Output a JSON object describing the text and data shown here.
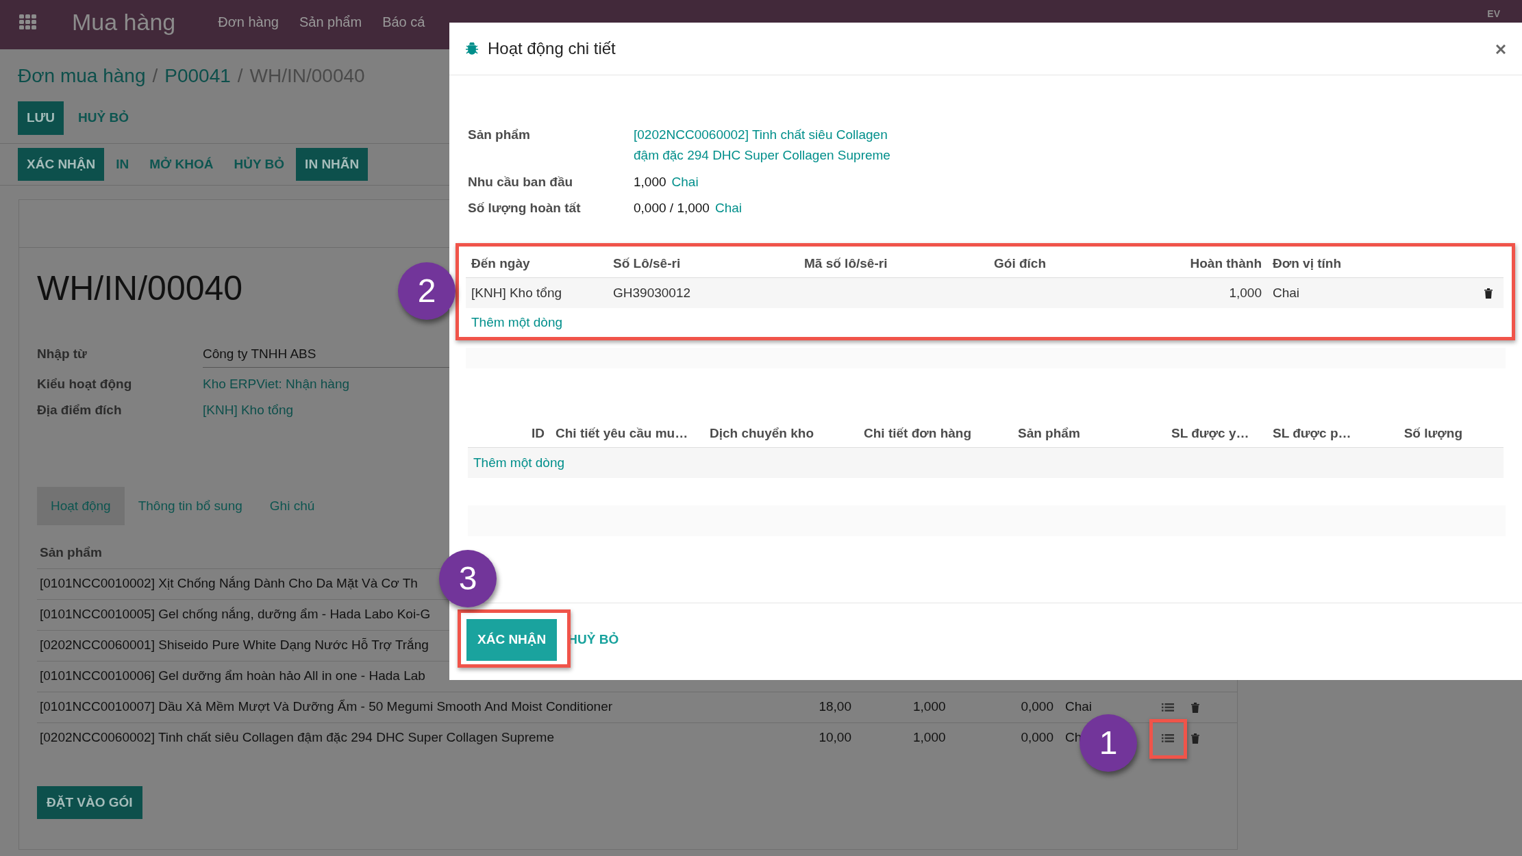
{
  "navbar": {
    "app": "Mua hàng",
    "menu": [
      "Đơn hàng",
      "Sản phẩm",
      "Báo cá"
    ],
    "user": "EV"
  },
  "breadcrumb": {
    "separator": "/",
    "items": [
      {
        "label": "Đơn mua hàng",
        "link": true
      },
      {
        "label": "P00041",
        "link": true
      },
      {
        "label": "WH/IN/00040",
        "link": false
      }
    ]
  },
  "edit_buttons": [
    {
      "label": "LƯU",
      "primary": true
    },
    {
      "label": "HUỶ BỎ",
      "primary": false
    }
  ],
  "status_buttons": [
    {
      "label": "XÁC NHẬN",
      "primary": true
    },
    {
      "label": "IN",
      "primary": false
    },
    {
      "label": "MỞ KHOÁ",
      "primary": false
    },
    {
      "label": "HỦY BỎ",
      "primary": false
    },
    {
      "label": "IN NHÃN",
      "primary": true
    }
  ],
  "record": {
    "title": "WH/IN/00040",
    "fields": [
      {
        "label": "Nhập từ",
        "value": "Công ty TNHH ABS",
        "kind": "input"
      },
      {
        "label": "Kiểu hoạt động",
        "value": "Kho ERPViet: Nhận hàng",
        "kind": "link"
      },
      {
        "label": "Địa điểm đích",
        "value": "[KNH] Kho tổng",
        "kind": "link"
      }
    ]
  },
  "tabs": [
    {
      "label": "Hoạt động",
      "selected": true
    },
    {
      "label": "Thông tin bổ sung",
      "selected": false
    },
    {
      "label": "Ghi chú",
      "selected": false
    }
  ],
  "operations": {
    "heading": "Sản phẩm",
    "rows": [
      {
        "product": "[0101NCC0010002] Xịt Chống Nắng Dành Cho Da Mặt Và Cơ Th"
      },
      {
        "product": "[0101NCC0010005] Gel chống nắng, dưỡng ẩm - Hada Labo Koi-G"
      },
      {
        "product": "[0202NCC0060001] Shiseido Pure White Dạng Nước Hỗ Trợ Trắng"
      },
      {
        "product": "[0101NCC0010006] Gel dưỡng ẩm hoàn hảo All in one - Hada Lab"
      },
      {
        "product": "[0101NCC0010007] Dầu Xả Mềm Mượt Và Dưỡng Ẩm - 50 Megumi Smooth And Moist Conditioner",
        "column_2": "18,00",
        "column_3": "1,000",
        "column_4": "0,000",
        "unit": "Chai"
      },
      {
        "product": "[0202NCC0060002] Tinh chất siêu Collagen đậm đặc 294 DHC Super Collagen Supreme",
        "column_2": "10,00",
        "column_3": "1,000",
        "column_4": "0,000",
        "unit": "Ch"
      }
    ]
  },
  "put_in_pack_button": "ĐẶT VÀO GÓI",
  "dialog": {
    "title": "Hoạt động chi tiết",
    "fields": [
      {
        "label": "Sản phẩm",
        "value": "[0202NCC0060002] Tinh chất siêu Collagen đậm đặc 294 DHC Super Collagen Supreme",
        "kind": "link"
      },
      {
        "label": "Nhu cầu ban đầu",
        "value": "1,000",
        "unit": "Chai",
        "kind": "quantity"
      },
      {
        "label": "Số lượng hoàn tất",
        "value": "0,000 / 1,000",
        "unit": "Chai",
        "kind": "quantity"
      }
    ],
    "move_lines": {
      "columns": [
        "Đến ngày",
        "Số Lô/sê-ri",
        "Mã số lô/sê-ri",
        "Gói đích",
        "Hoàn thành",
        "Đơn vị tính"
      ],
      "rows": [
        {
          "location": "[KNH] Kho tổng",
          "lot": "GH39030012",
          "done": "1,000",
          "unit": "Chai"
        }
      ],
      "add_line": "Thêm một dòng"
    },
    "second_table": {
      "columns": [
        "ID",
        "Chi tiết yêu cầu mu…",
        "Dịch chuyển kho",
        "Chi tiết đơn hàng",
        "Sản phẩm",
        "SL được y…",
        "SL được p…",
        "Số lượng"
      ],
      "add_line": "Thêm một dòng"
    },
    "buttons": [
      {
        "label": "XÁC NHẬN",
        "primary": true
      },
      {
        "label": "HUỶ BỎ",
        "primary": false
      }
    ]
  },
  "annotations": [
    {
      "number": "1"
    },
    {
      "number": "2"
    },
    {
      "number": "3"
    }
  ]
}
